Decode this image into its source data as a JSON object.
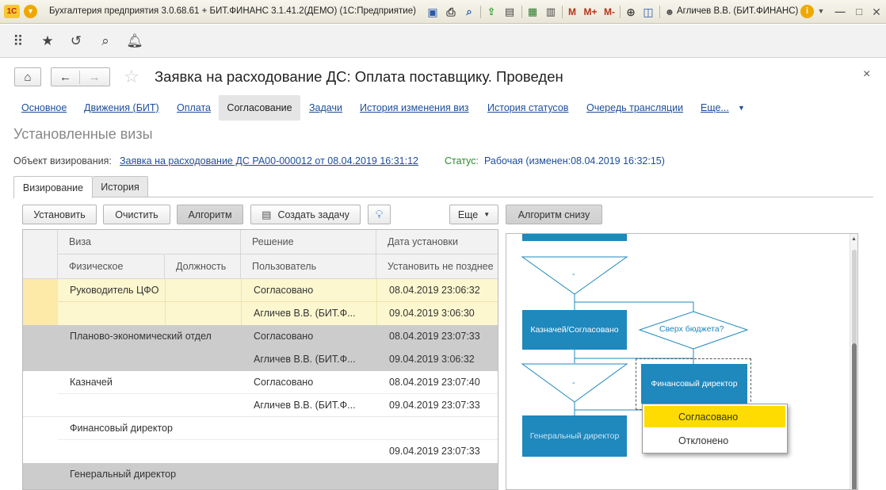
{
  "titlebar": {
    "title": "Бухгалтерия предприятия 3.0.68.61 + БИТ.ФИНАНС 3.1.41.2(ДЕМО)  (1С:Предприятие)",
    "user": "Агличев В.В. (БИТ.ФИНАНС)",
    "logo": "1С",
    "mem_buttons": [
      "M",
      "M+",
      "M-"
    ],
    "info_icon": "i"
  },
  "header": {
    "title": "Заявка на расходование ДС: Оплата поставщику. Проведен",
    "close": "×"
  },
  "tabs": [
    {
      "label": "Основное"
    },
    {
      "label": "Движения (БИТ)"
    },
    {
      "label": "Оплата"
    },
    {
      "label": "Согласование",
      "active": true
    },
    {
      "label": "Задачи"
    },
    {
      "label": "История изменения виз"
    },
    {
      "label": "История статусов"
    },
    {
      "label": "Очередь трансляции"
    },
    {
      "label": "Еще..."
    }
  ],
  "section": {
    "title": "Установленные визы"
  },
  "object": {
    "label": "Объект визирования:",
    "link": "Заявка на расходование ДС РА00-000012 от 08.04.2019 16:31:12",
    "status_label": "Статус:",
    "status_value": "Рабочая (изменен:08.04.2019 16:32:15)"
  },
  "inner_tabs": [
    {
      "label": "Визирование",
      "active": true
    },
    {
      "label": "История"
    }
  ],
  "toolbar": {
    "install": "Установить",
    "clear": "Очистить",
    "algorithm": "Алгоритм",
    "create_task": "Создать задачу",
    "more": "Еще",
    "algorithm_bottom": "Алгоритм снизу"
  },
  "grid": {
    "headers": {
      "viza": "Виза",
      "fizicheskoe": "Физическое",
      "dolzhnost": "Должность",
      "reshenie": "Решение",
      "polzovatel": "Пользователь",
      "data": "Дата установки",
      "ustanovit_ne_pozdnee": "Установить не позднее"
    },
    "rows": [
      {
        "viza": "Руководитель ЦФО",
        "reshenie": "Согласовано",
        "user": "Агличев В.В. (БИТ.Ф...",
        "date": "08.04.2019 23:06:32",
        "deadline": "09.04.2019 3:06:30"
      },
      {
        "viza": "Планово-экономический отдел",
        "reshenie": "Согласовано",
        "user": "Агличев В.В. (БИТ.Ф...",
        "date": "08.04.2019 23:07:33",
        "deadline": "09.04.2019 3:06:32"
      },
      {
        "viza": "Казначей",
        "reshenie": "Согласовано",
        "user": "Агличев В.В. (БИТ.Ф...",
        "date": "08.04.2019 23:07:40",
        "deadline": "09.04.2019 23:07:33"
      },
      {
        "viza": "Финансовый директор",
        "reshenie": "",
        "user": "",
        "date": "",
        "deadline": "09.04.2019 23:07:33"
      },
      {
        "viza": "Генеральный директор",
        "reshenie": "",
        "user": "",
        "date": "",
        "deadline": ""
      }
    ]
  },
  "diagram": {
    "dash": "-",
    "treasurer": "Казначей/Согласовано",
    "over_budget": "Сверх бюджета?",
    "fin_director": "Финансовый директор",
    "gen_director": "Генеральный директор"
  },
  "popup": {
    "items": [
      {
        "label": "Согласовано",
        "selected": true
      },
      {
        "label": "Отклонено"
      }
    ]
  },
  "colors": {
    "link": "#1c4e9a",
    "status_label": "#2a8a2a",
    "node": "#1f88bd",
    "row_yellow": "#fdf7d0",
    "row_gray": "#cccccc",
    "popup_selected": "#fedc01"
  }
}
